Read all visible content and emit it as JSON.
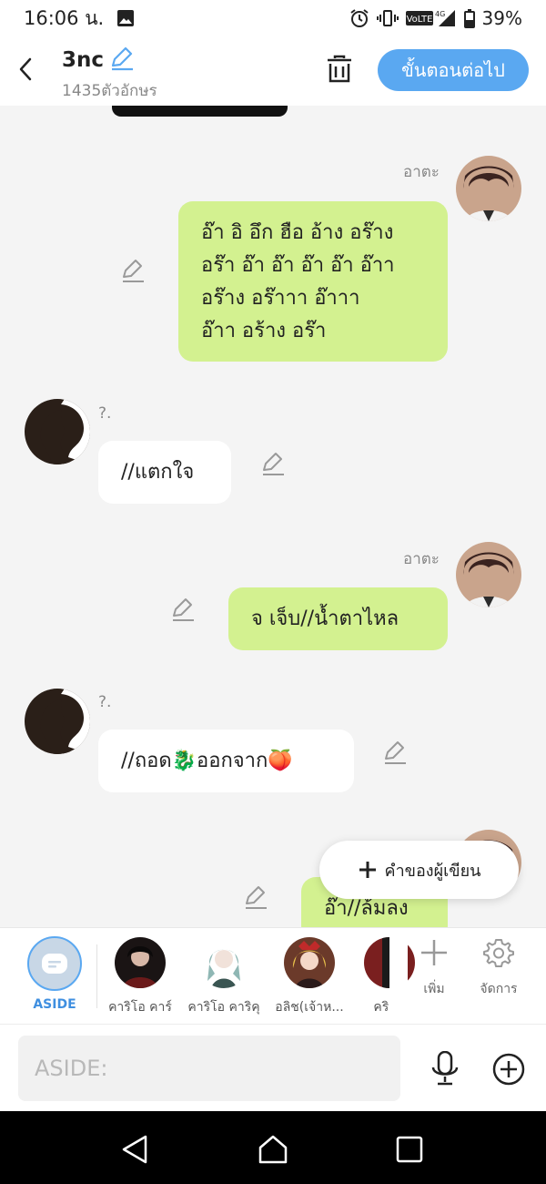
{
  "status_bar": {
    "time": "16:06 น.",
    "battery": "39%",
    "network": "VoLTE",
    "net_gen": "4G"
  },
  "header": {
    "title": "3nc",
    "char_count": "1435ตัวอักษร",
    "next_label": "ขั้นตอนต่อไป"
  },
  "messages": [
    {
      "sender": "อาตะ",
      "side": "right",
      "lines": [
        "อ๊า อิ อึก ฮือ อ้าง อร๊าง",
        "อร๊า อ๊า อ๊า อ๊า อ๊า อ๊าา",
        "อร๊าง อร๊าาา อ๊าาา",
        "อ๊าา อร้าง อร๊า"
      ]
    },
    {
      "sender": "?.",
      "side": "left",
      "lines": [
        "//แตกใจ"
      ]
    },
    {
      "sender": "อาตะ",
      "side": "right",
      "lines": [
        "จ เจ็บ//น้ำตาไหล"
      ]
    },
    {
      "sender": "?.",
      "side": "left",
      "lines": [
        "//ถอด🐉ออกจาก🍑"
      ]
    },
    {
      "sender": "",
      "side": "right",
      "lines": [
        "อ๊า//ล้มลง"
      ]
    }
  ],
  "writer_note_label": "คำของผู้เขียน",
  "characters": {
    "aside_label": "ASIDE",
    "items": [
      {
        "label": "คาริโอ คาร์"
      },
      {
        "label": "คาริโอ คาริคุ"
      },
      {
        "label": "อลิช(เจ้าห..."
      },
      {
        "label": "คริส ("
      }
    ],
    "add_label": "เพิ่ม",
    "manage_label": "จัดการ"
  },
  "input": {
    "placeholder": "ASIDE:"
  },
  "colors": {
    "accent": "#5aa8f1",
    "my_bubble": "#d3f190",
    "other_bubble": "#ffffff",
    "background": "#f4f4f4"
  }
}
